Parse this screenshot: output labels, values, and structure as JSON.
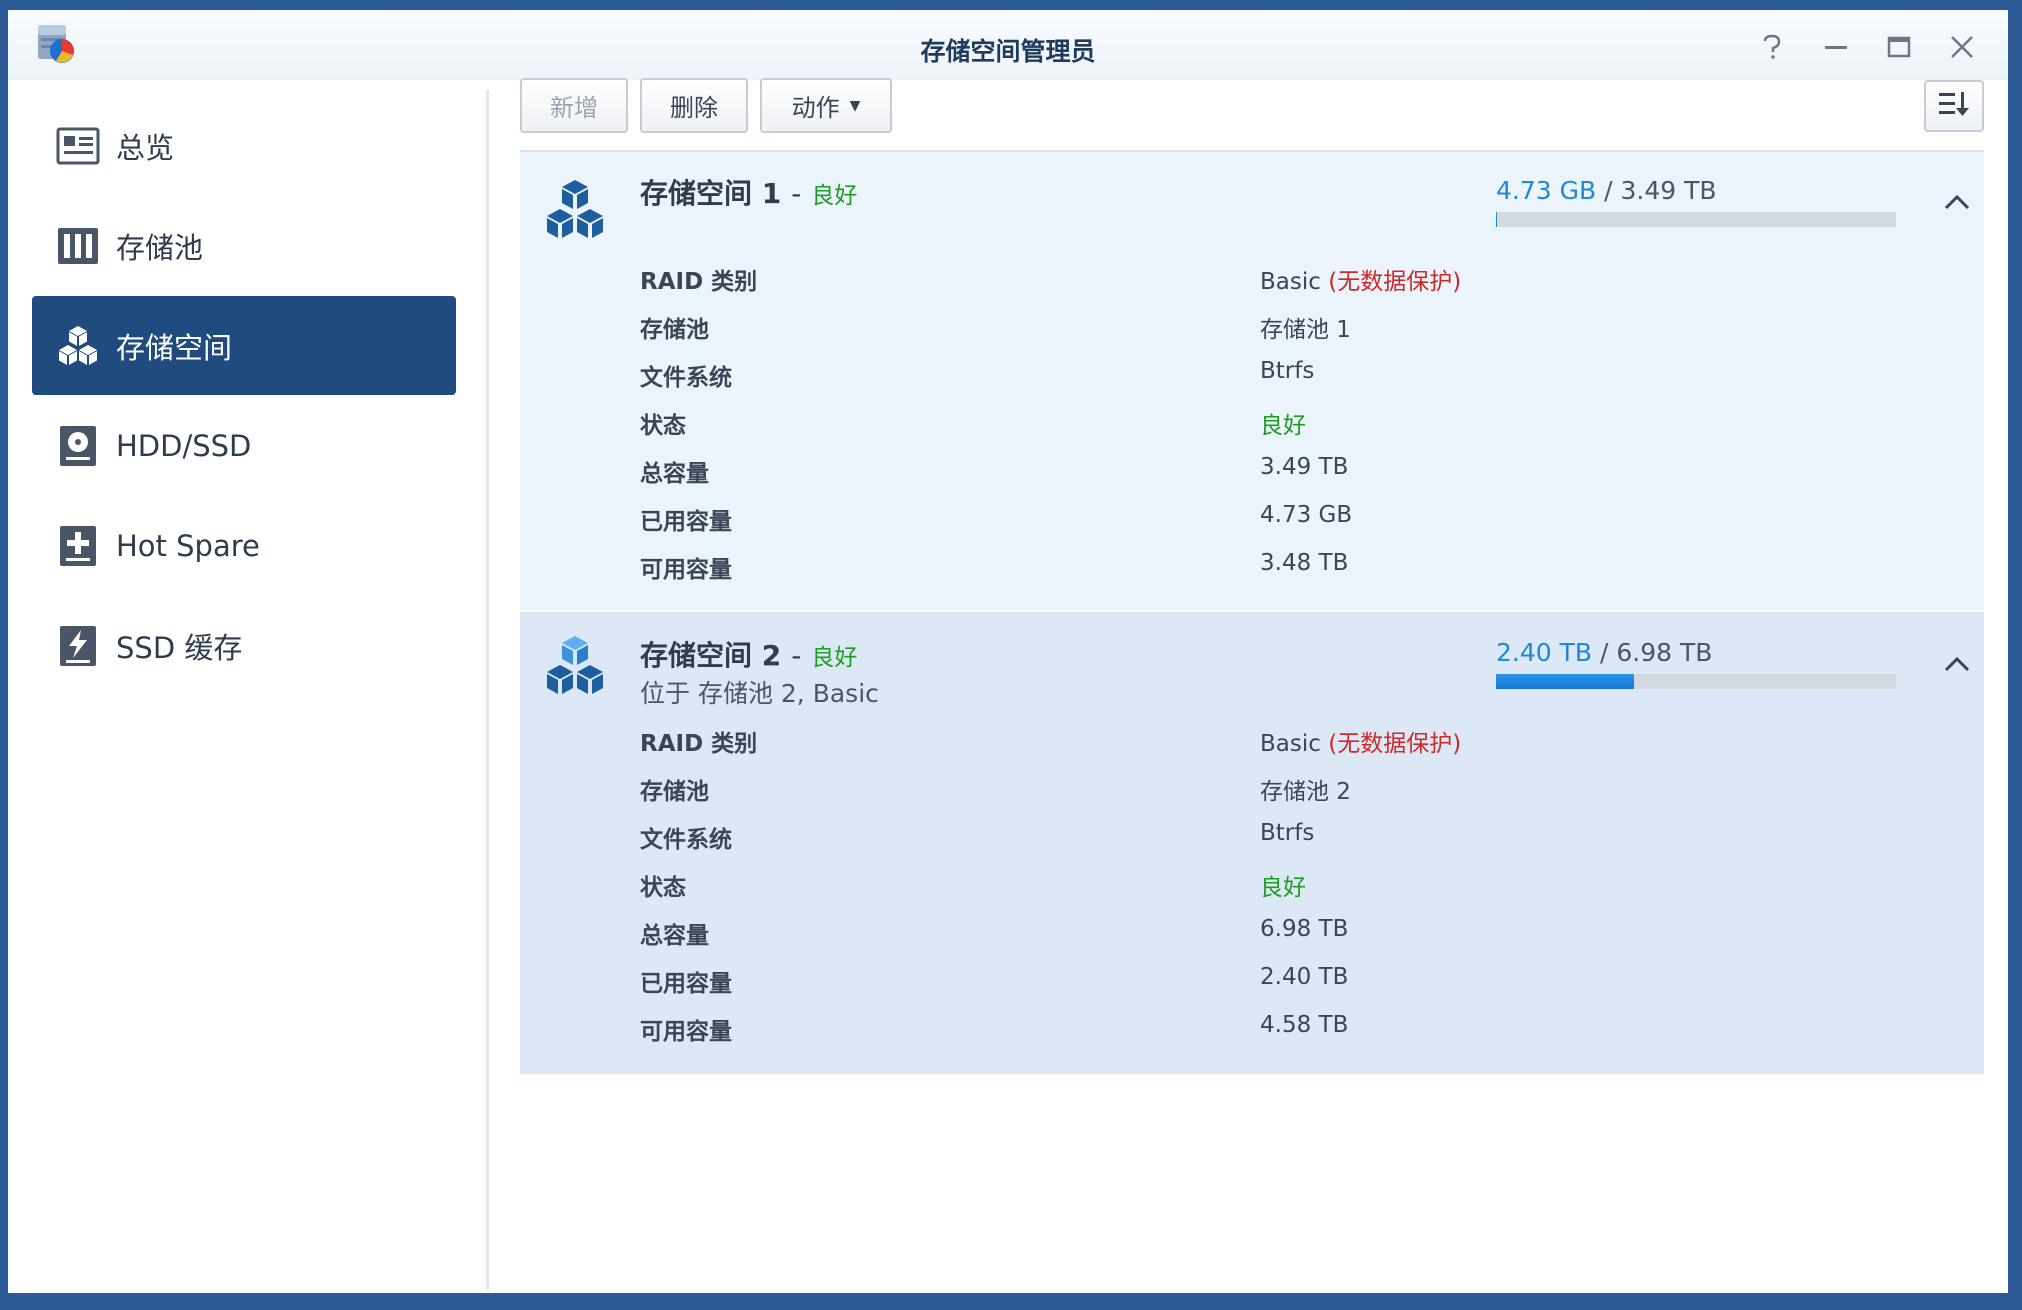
{
  "window": {
    "title": "存储空间管理员"
  },
  "sidebar": {
    "items": [
      {
        "label": "总览"
      },
      {
        "label": "存储池"
      },
      {
        "label": "存储空间"
      },
      {
        "label": "HDD/SSD"
      },
      {
        "label": "Hot Spare"
      },
      {
        "label": "SSD 缓存"
      }
    ]
  },
  "toolbar": {
    "new_label": "新增",
    "delete_label": "删除",
    "action_label": "动作"
  },
  "volumes": [
    {
      "name": "存储空间 1",
      "status": "良好",
      "usage_used": "4.73 GB",
      "usage_total": "3.49 TB",
      "usage_fraction": 0.0013,
      "details": {
        "raid_label": "RAID 类别",
        "raid_value": "Basic",
        "raid_warning": "(无数据保护)",
        "pool_label": "存储池",
        "pool_value": "存储池 1",
        "fs_label": "文件系统",
        "fs_value": "Btrfs",
        "status_label": "状态",
        "status_value": "良好",
        "total_label": "总容量",
        "total_value": "3.49 TB",
        "used_label": "已用容量",
        "used_value": "4.73 GB",
        "free_label": "可用容量",
        "free_value": "3.48 TB"
      }
    },
    {
      "name": "存储空间 2",
      "status": "良好",
      "subtitle": "位于 存储池 2, Basic",
      "usage_used": "2.40 TB",
      "usage_total": "6.98 TB",
      "usage_fraction": 0.344,
      "details": {
        "raid_label": "RAID 类别",
        "raid_value": "Basic",
        "raid_warning": "(无数据保护)",
        "pool_label": "存储池",
        "pool_value": "存储池 2",
        "fs_label": "文件系统",
        "fs_value": "Btrfs",
        "status_label": "状态",
        "status_value": "良好",
        "total_label": "总容量",
        "total_value": "6.98 TB",
        "used_label": "已用容量",
        "used_value": "2.40 TB",
        "free_label": "可用容量",
        "free_value": "4.58 TB"
      }
    }
  ],
  "colors": {
    "accent": "#1f4b7e",
    "status_good": "#1f9c23",
    "warning": "#cc2a2a",
    "usage": "#1e89d6"
  }
}
